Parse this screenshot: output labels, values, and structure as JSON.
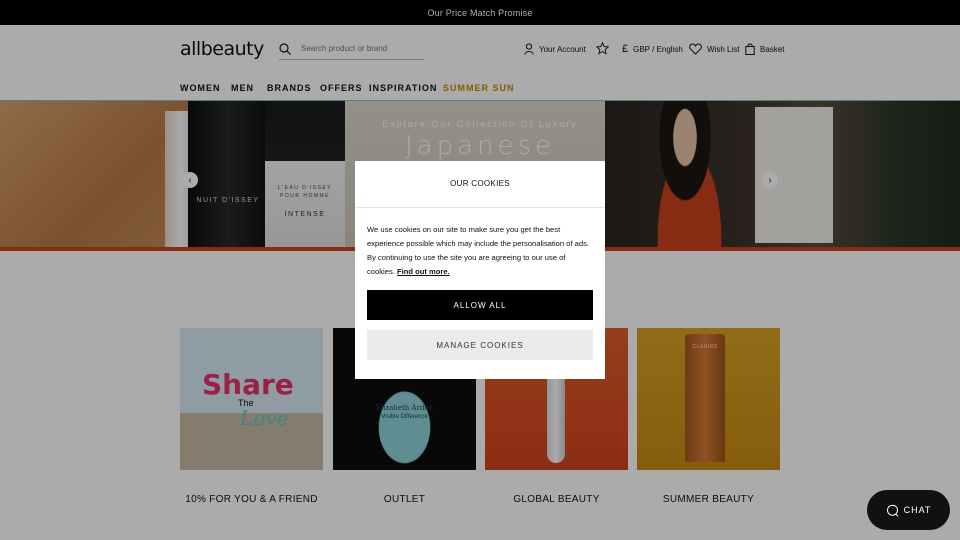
{
  "promo": {
    "text": "Our Price Match Promise"
  },
  "header": {
    "logo": "allbeauty",
    "search_placeholder": "Search product or brand",
    "account": "Your Account",
    "currency": "GBP / English",
    "currency_symbol": "£",
    "wishlist": "Wish List",
    "basket": "Basket"
  },
  "nav": {
    "items": [
      "WOMEN",
      "MEN",
      "BRANDS",
      "OFFERS",
      "INSPIRATION",
      "SUMMER SUN"
    ],
    "highlight_color": "#c98a00"
  },
  "hero": {
    "kicker": "Explore Our Collection Of Luxury",
    "title": "Japanese",
    "bottle_left_label": "NUIT D'ISSEY",
    "bottle_right_label_line1": "L'EAU D'ISSEY",
    "bottle_right_label_line2": "POUR HOMME",
    "bottle_right_label_line3": "INTENSE",
    "prev_icon": "chevron-left-icon",
    "next_icon": "chevron-right-icon"
  },
  "tiles": [
    {
      "label": "10% FOR YOU & A FRIEND",
      "art_main": "Share",
      "art_sub": "The",
      "art_script": "Love"
    },
    {
      "label": "OUTLET",
      "art_brand": "Elizabeth Arden",
      "art_product": "Visible Difference"
    },
    {
      "label": "GLOBAL BEAUTY"
    },
    {
      "label": "SUMMER BEAUTY",
      "art_brand": "CLARINS"
    }
  ],
  "cookie_modal": {
    "title": "OUR COOKIES",
    "body": "We use cookies on our site to make sure you get the best experience possible which may include the personalisation of ads. By continuing to use the site you are agreeing to our use of cookies.",
    "link": "Find out more.",
    "allow_label": "ALLOW ALL",
    "manage_label": "MANAGE COOKIES"
  },
  "chat": {
    "label": "CHAT"
  },
  "colors": {
    "accent": "#c98a00",
    "primary_button": "#000000",
    "hero_strip": "#c8401a"
  }
}
